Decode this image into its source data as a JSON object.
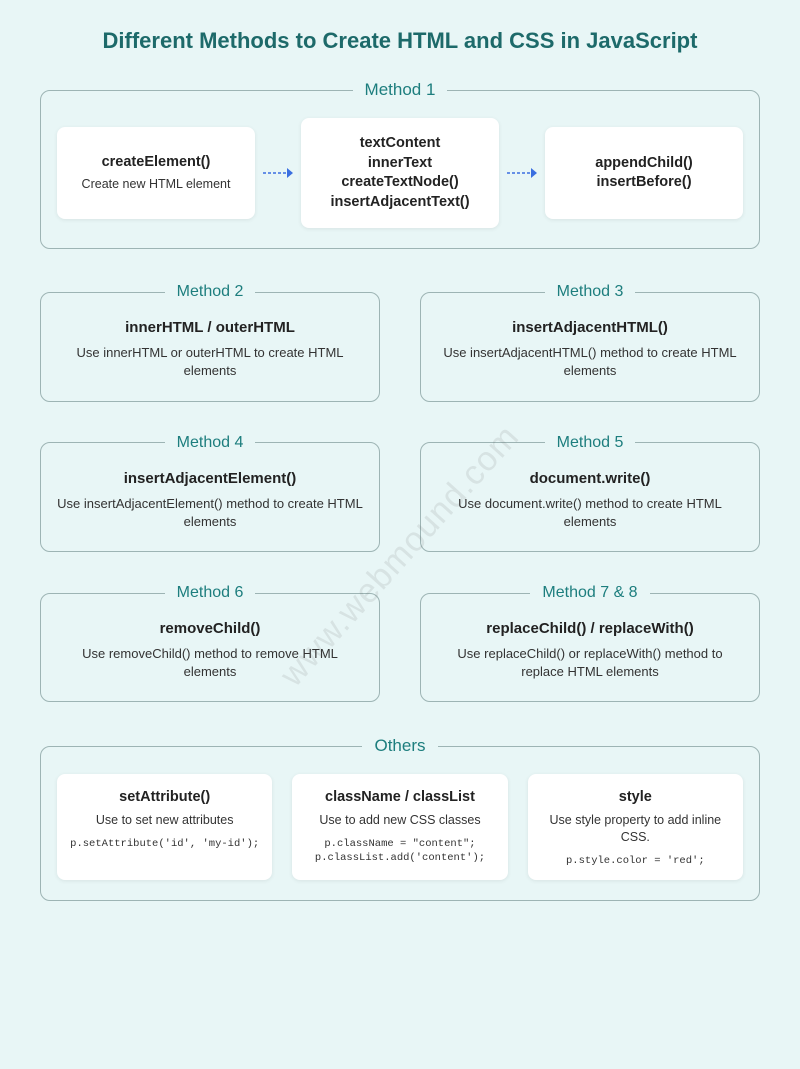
{
  "title": "Different Methods to Create HTML and CSS in JavaScript",
  "watermark": "www.webmound.com",
  "method1": {
    "legend": "Method 1",
    "step1": {
      "title": "createElement()",
      "desc": "Create new HTML element"
    },
    "step2": {
      "lines": [
        "textContent",
        "innerText",
        "createTextNode()",
        "insertAdjacentText()"
      ]
    },
    "step3": {
      "lines": [
        "appendChild()",
        "insertBefore()"
      ]
    }
  },
  "methods": [
    {
      "legend": "Method 2",
      "title": "innerHTML / outerHTML",
      "desc": "Use innerHTML or outerHTML to create HTML elements"
    },
    {
      "legend": "Method 3",
      "title": "insertAdjacentHTML()",
      "desc": "Use insertAdjacentHTML() method to create HTML elements"
    },
    {
      "legend": "Method 4",
      "title": "insertAdjacentElement()",
      "desc": "Use insertAdjacentElement() method to create HTML elements"
    },
    {
      "legend": "Method 5",
      "title": "document.write()",
      "desc": "Use document.write() method to create HTML elements"
    },
    {
      "legend": "Method 6",
      "title": "removeChild()",
      "desc": "Use removeChild() method to remove HTML elements"
    },
    {
      "legend": "Method 7 & 8",
      "title": "replaceChild() / replaceWith()",
      "desc": "Use replaceChild() or replaceWith() method to replace HTML elements"
    }
  ],
  "others": {
    "legend": "Others",
    "items": [
      {
        "title": "setAttribute()",
        "desc": "Use to set new attributes",
        "code": "p.setAttribute('id', 'my-id');"
      },
      {
        "title": "className / classList",
        "desc": "Use to add new CSS classes",
        "code": "p.className = \"content\";\np.classList.add('content');"
      },
      {
        "title": "style",
        "desc": "Use style property to add inline CSS.",
        "code": "p.style.color = 'red';"
      }
    ]
  }
}
